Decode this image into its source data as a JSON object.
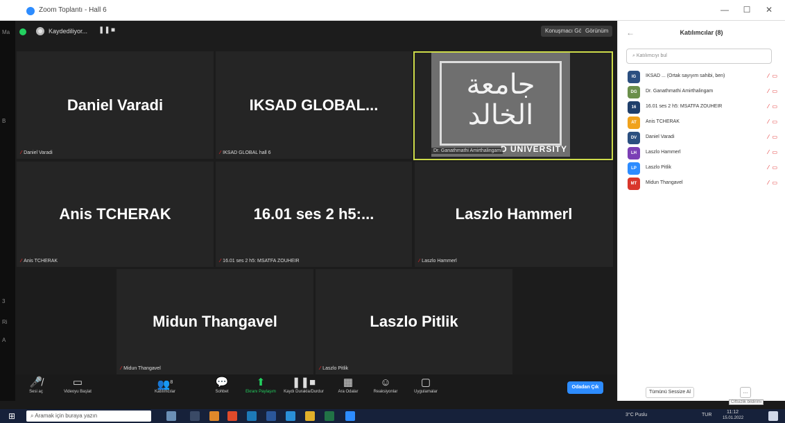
{
  "window": {
    "title": "Zoom Toplantı - Hall 6",
    "minimize": "—",
    "maximize": "☐",
    "close": "✕"
  },
  "left_strip": {
    "items": [
      "Ma",
      "B",
      "3",
      "Ri",
      "A"
    ]
  },
  "topbar": {
    "recording_label": "Kaydediliyor...",
    "pause": "❚❚",
    "stop": "■",
    "speaker_view": "Konuşmacı Görünümü",
    "gallery_view": "Görünüm"
  },
  "tiles": [
    {
      "name": "Daniel Varadi",
      "label": "Daniel Varadi"
    },
    {
      "name": "IKSAD  GLOBAL...",
      "label": "IKSAD GLOBAL hall 6"
    },
    {
      "name": "",
      "label": "Dr. Ganathmathi Amirthalingam",
      "logo_text": "جامعة الخالد",
      "logo_university": "D UNIVERSITY"
    },
    {
      "name": "Anis TCHERAK",
      "label": "Anis TCHERAK"
    },
    {
      "name": "16.01 ses 2 h5:...",
      "label": "16.01 ses 2 h5: MSATFA ZOUHEIR"
    },
    {
      "name": "Laszlo Hammerl",
      "label": "Laszlo Hammerl"
    },
    {
      "name": "Midun Thangavel",
      "label": "Midun Thangavel"
    },
    {
      "name": "Laszlo Pitlik",
      "label": "Laszlo Pitlik"
    }
  ],
  "toolbar": {
    "audio": "Sesi aç",
    "video": "Videoyu Başlat",
    "participants": "Katılımcılar",
    "participants_count": "8",
    "chat": "Sohbet",
    "share": "Ekranı Paylaşım",
    "record": "Kaydı Durakla/Durdur",
    "breakout": "Ara Odalar",
    "reactions": "Reaksiyonlar",
    "apps": "Uygulamalar",
    "leave": "Odadan Çık"
  },
  "panel": {
    "title": "Katılımcılar (8)",
    "search_placeholder": "Katılımcıyı bul",
    "participants": [
      {
        "initials": "IG",
        "name": "IKSAD ... (Ortak sayıyım sahibi, ben)",
        "color": "#2b4f80"
      },
      {
        "initials": "DG",
        "name": "Dr. Ganathmathi Amirthalingam",
        "color": "#6a8f4a"
      },
      {
        "initials": "16",
        "name": "16.01 ses 2 h5: MSATFA ZOUHEIR",
        "color": "#1f3f6b"
      },
      {
        "initials": "AT",
        "name": "Anis TCHERAK",
        "color": "#f0a21c"
      },
      {
        "initials": "DV",
        "name": "Daniel Varadi",
        "color": "#2b4f80"
      },
      {
        "initials": "LH",
        "name": "Laszlo Hammerl",
        "color": "#7b3fb5"
      },
      {
        "initials": "LP",
        "name": "Laszlo Pitlik",
        "color": "#2d8cff"
      },
      {
        "initials": "MT",
        "name": "Midun Thangavel",
        "color": "#d9362b"
      }
    ],
    "invite": "Tümünü Sessize Al",
    "more": "...",
    "hint": "Ciftsizlik bildirimi"
  },
  "taskbar": {
    "search_placeholder": "Aramak için buraya yazın",
    "weather": "3°C Puslu",
    "lang": "TUR",
    "time": "11:12",
    "date": "15.01.2022"
  }
}
